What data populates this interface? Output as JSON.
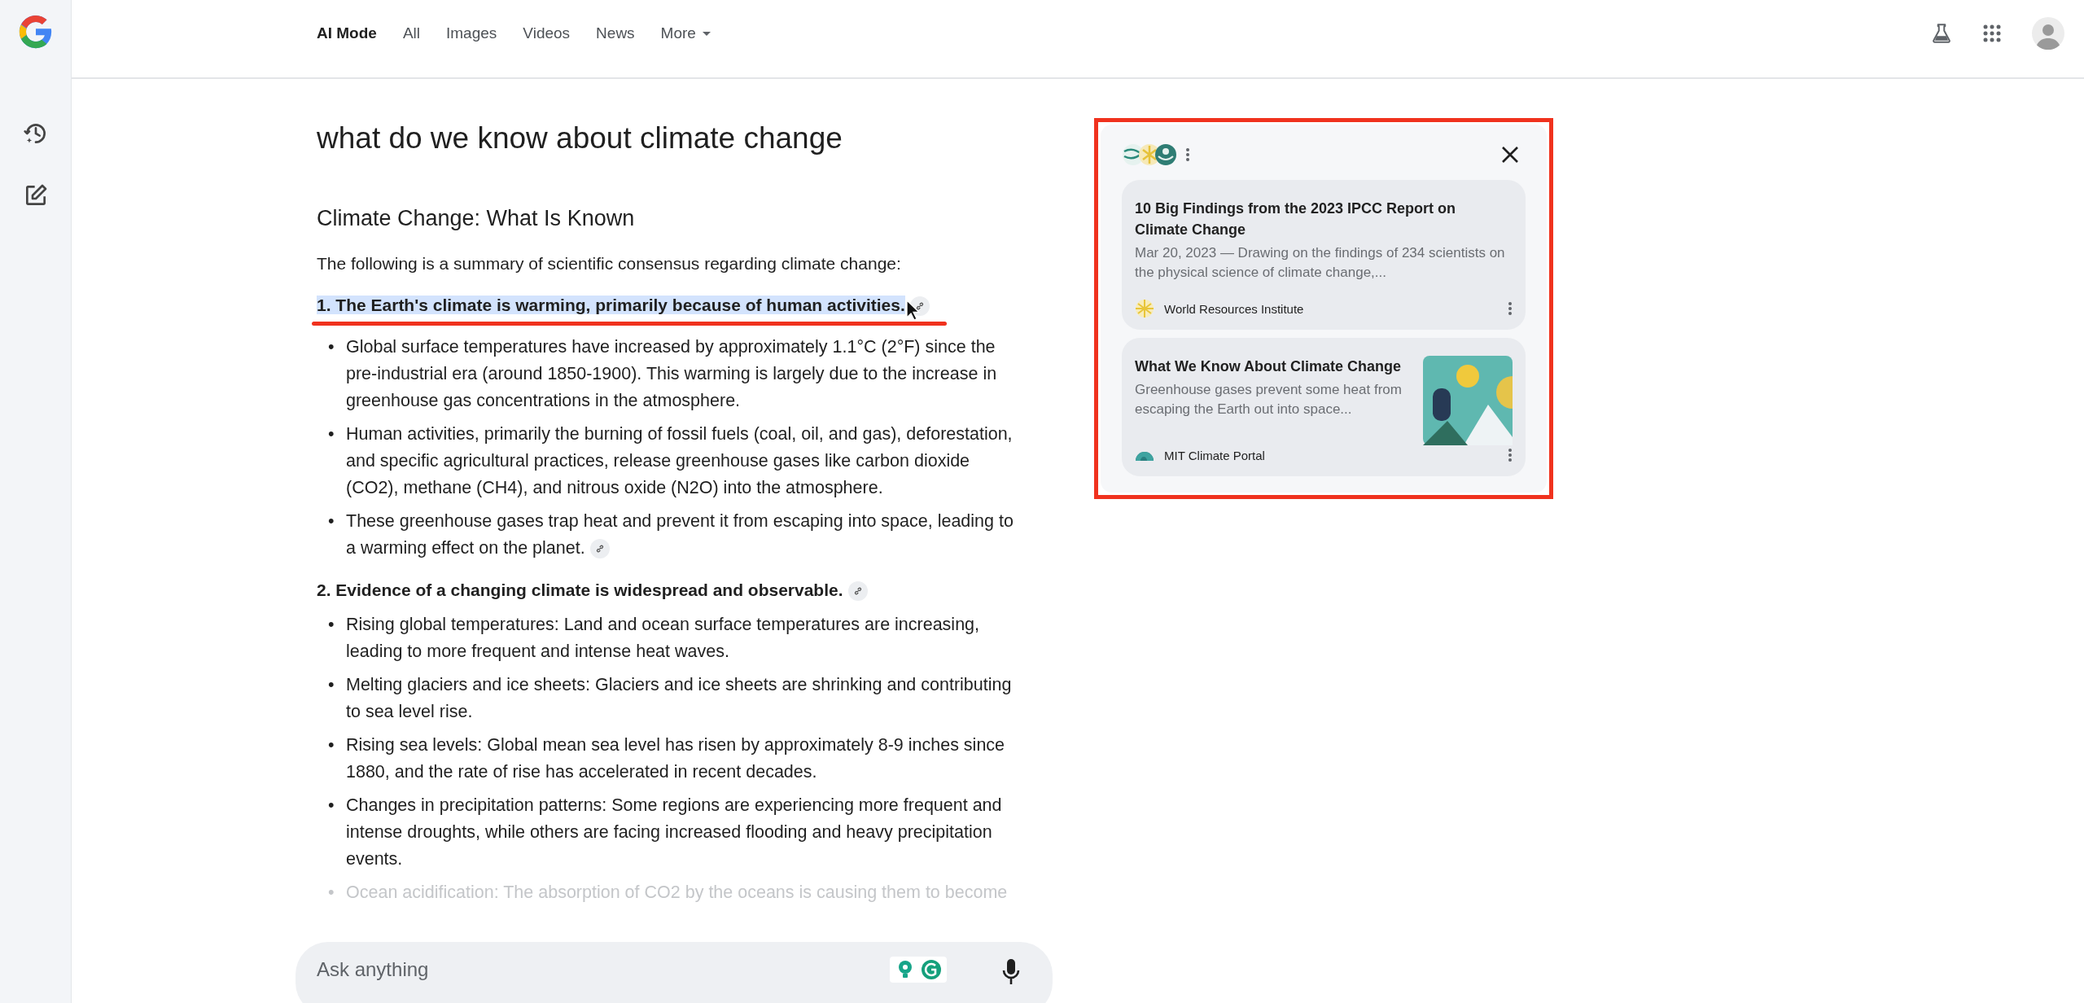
{
  "nav": {
    "tabs": [
      {
        "label": "AI Mode",
        "selected": true,
        "dropdown": false
      },
      {
        "label": "All",
        "selected": false,
        "dropdown": false
      },
      {
        "label": "Images",
        "selected": false,
        "dropdown": false
      },
      {
        "label": "Videos",
        "selected": false,
        "dropdown": false
      },
      {
        "label": "News",
        "selected": false,
        "dropdown": false
      },
      {
        "label": "More",
        "selected": false,
        "dropdown": true
      }
    ]
  },
  "query": "what do we know about climate change",
  "answer": {
    "heading": "Climate Change: What Is Known",
    "intro": "The following is a summary of scientific consensus regarding climate change:",
    "sections": [
      {
        "title": "1. The Earth's climate is warming, primarily because of human activities.",
        "highlighted": true,
        "has_link": true,
        "bullets": [
          {
            "marker": "•",
            "text": "Global surface temperatures have increased by approximately 1.1°C (2°F) since the pre-industrial era (around 1850-1900). This warming is largely due to the increase in greenhouse gas concentrations in the atmosphere.",
            "has_link": false,
            "faded": false
          },
          {
            "marker": "•",
            "text": "Human activities, primarily the burning of fossil fuels (coal, oil, and gas), deforestation, and specific agricultural practices, release greenhouse gases like carbon dioxide (CO2), methane (CH4), and nitrous oxide (N2O) into the atmosphere.",
            "has_link": false,
            "faded": false
          },
          {
            "marker": "•",
            "text": "These greenhouse gases trap heat and prevent it from escaping into space, leading to a warming effect on the planet.",
            "has_link": true,
            "faded": false
          }
        ]
      },
      {
        "title": "2. Evidence of a changing climate is widespread and observable.",
        "highlighted": false,
        "has_link": true,
        "bullets": [
          {
            "marker": "•",
            "text": "Rising global temperatures: Land and ocean surface temperatures are increasing, leading to more frequent and intense heat waves.",
            "has_link": false,
            "faded": false
          },
          {
            "marker": "•",
            "text": "Melting glaciers and ice sheets: Glaciers and ice sheets are shrinking and contributing to sea level rise.",
            "has_link": false,
            "faded": false
          },
          {
            "marker": "•",
            "text": "Rising sea levels: Global mean sea level has risen by approximately 8-9 inches since 1880, and the rate of rise has accelerated in recent decades.",
            "has_link": false,
            "faded": false
          },
          {
            "marker": "•",
            "text": "Changes in precipitation patterns: Some regions are experiencing more frequent and intense droughts, while others are facing increased flooding and heavy precipitation events.",
            "has_link": false,
            "faded": false
          },
          {
            "marker": "•",
            "text": "Ocean acidification: The absorption of CO2 by the oceans is causing them to become",
            "has_link": false,
            "faded": true
          }
        ]
      }
    ]
  },
  "sources_panel": {
    "cards": [
      {
        "title": "10 Big Findings from the 2023 IPCC Report on Climate Change",
        "snippet": "Mar 20, 2023 — Drawing on the findings of 234 scientists on the physical science of climate change,...",
        "source": "World Resources Institute",
        "kind": "lattice",
        "has_thumbnail": false
      },
      {
        "title": "What We Know About Climate Change",
        "snippet": "Greenhouse gases prevent some heat from escaping the Earth out into space...",
        "source": "MIT Climate Portal",
        "kind": "dome",
        "has_thumbnail": true
      }
    ]
  },
  "ask_bar": {
    "placeholder": "Ask anything"
  }
}
